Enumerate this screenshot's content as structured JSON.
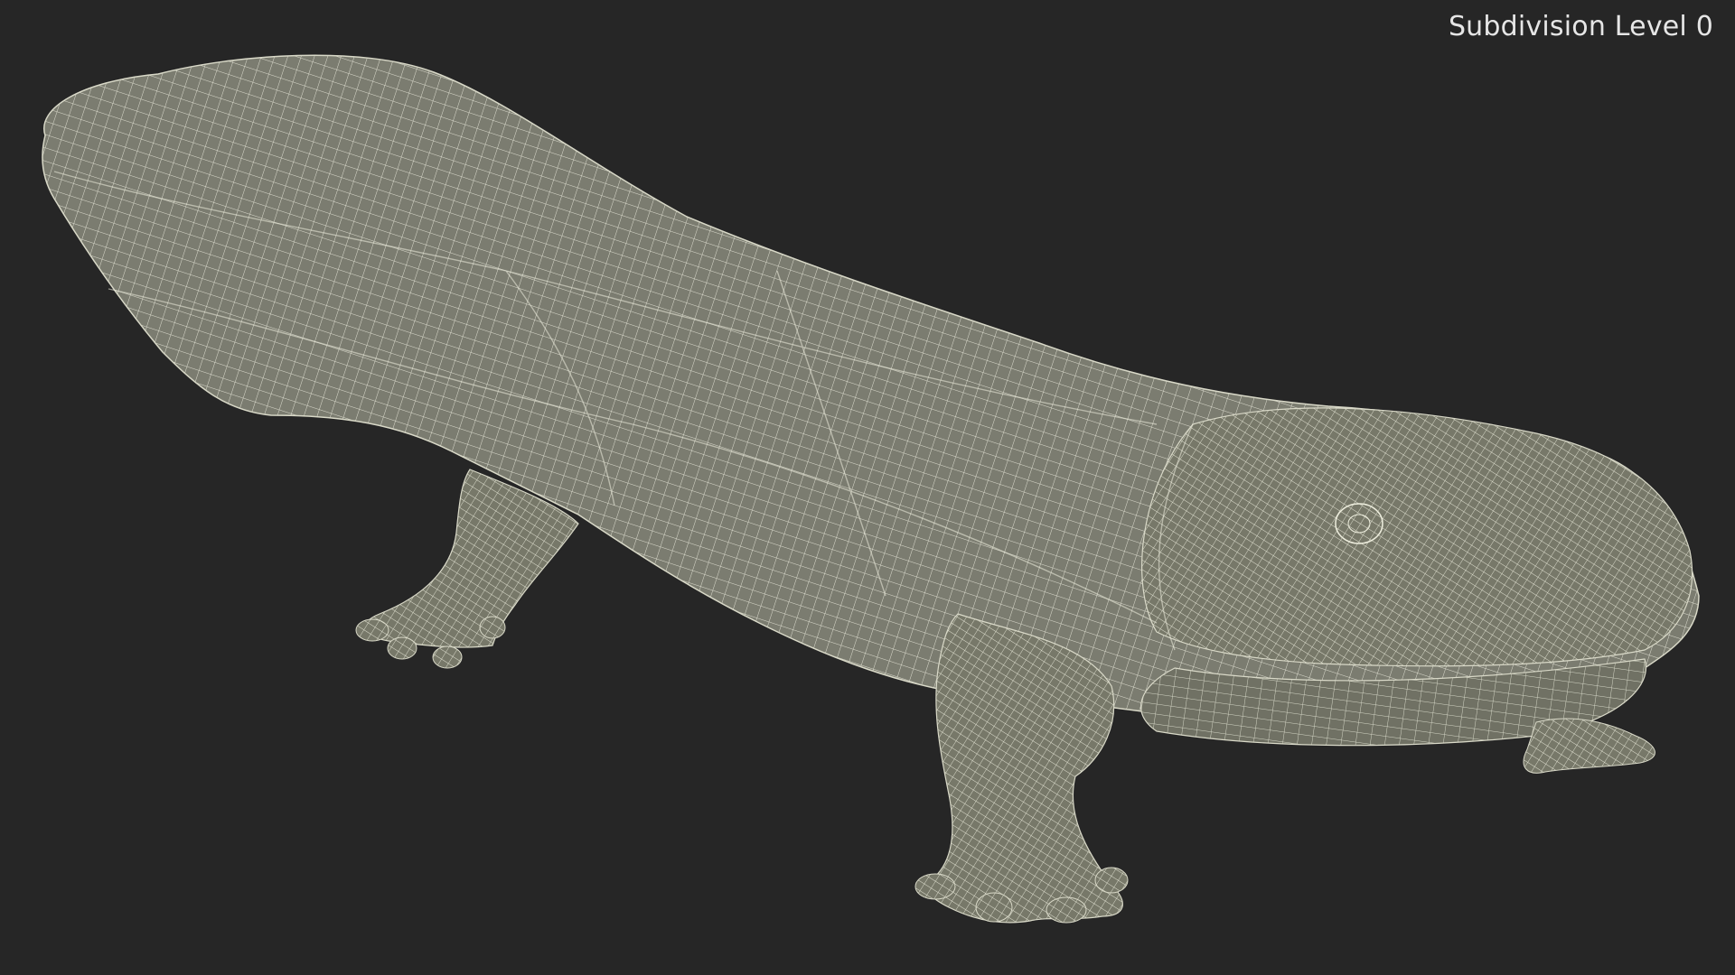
{
  "viewport": {
    "label": "Subdivision Level 0",
    "background_color": "#262626",
    "mesh_fill_color": "#7b7c70",
    "wire_color": "#eeeede",
    "subject": "salamander-wireframe-model"
  }
}
